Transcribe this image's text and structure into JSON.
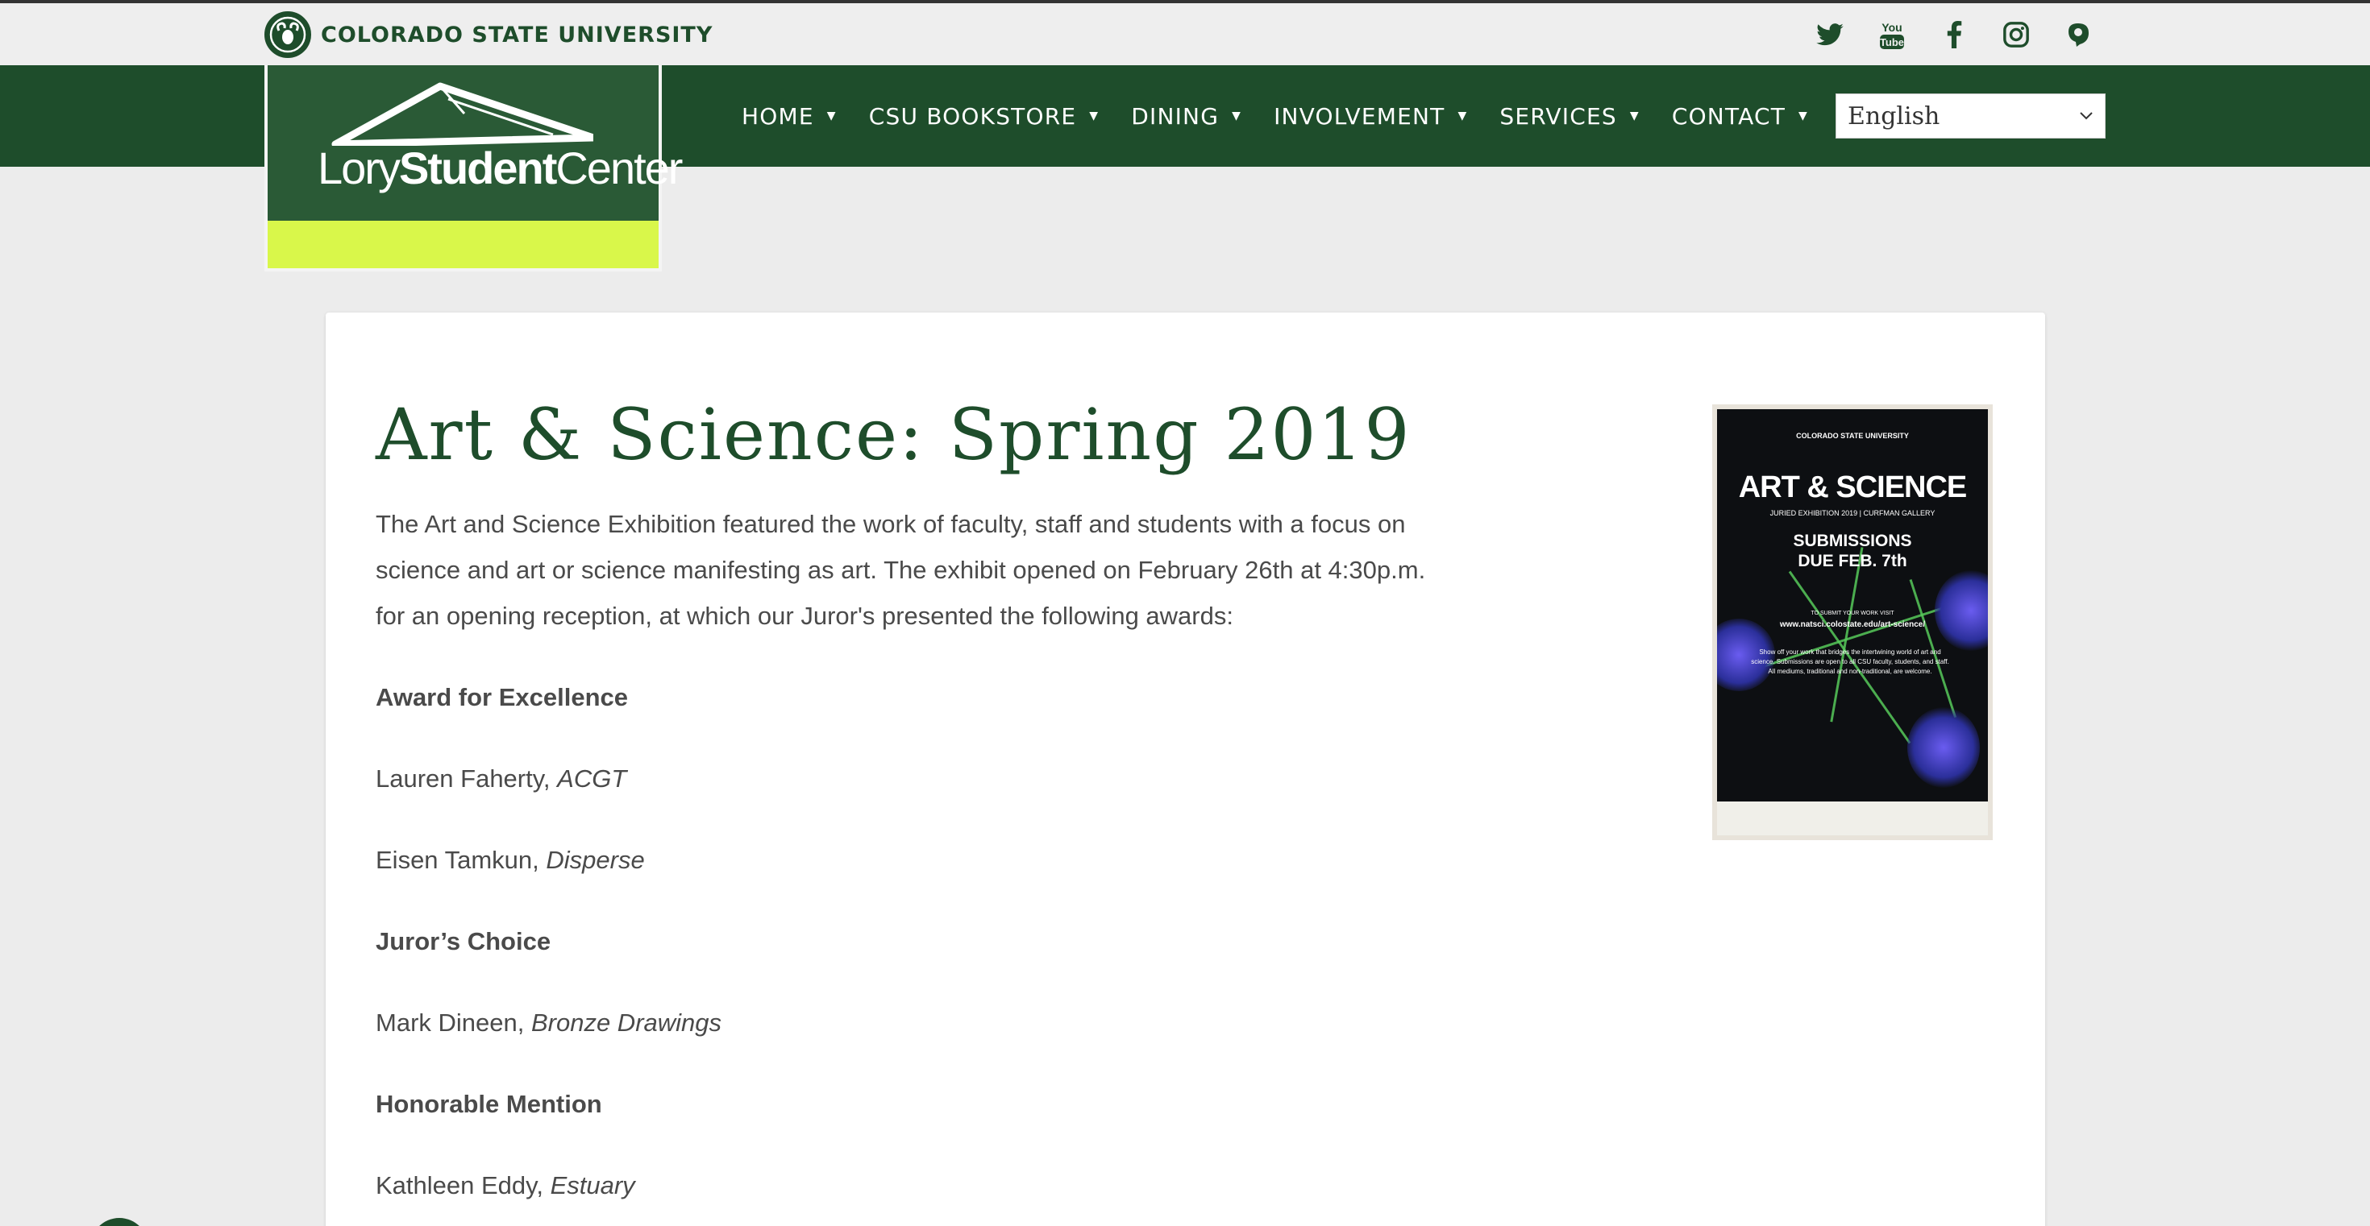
{
  "header": {
    "university_name": "COLORADO STATE UNIVERSITY",
    "social_icons": [
      "twitter-icon",
      "youtube-icon",
      "facebook-icon",
      "instagram-icon",
      "ram-icon"
    ],
    "youtube_label": "You Tube"
  },
  "logo": {
    "text_light_1": "Lory",
    "text_bold": "Student",
    "text_light_2": "Center"
  },
  "nav": {
    "items": [
      {
        "label": "HOME"
      },
      {
        "label": "CSU BOOKSTORE"
      },
      {
        "label": "DINING"
      },
      {
        "label": "INVOLVEMENT"
      },
      {
        "label": "SERVICES"
      },
      {
        "label": "CONTACT"
      }
    ],
    "language": "English"
  },
  "article": {
    "title": "Art & Science: Spring 2019",
    "intro": "The Art and Science Exhibition featured the work of faculty, staff and students with a focus on science and art or science manifesting as art. The exhibit opened on February 26th at 4:30p.m. for an opening reception, at which our Juror's presented the following awards:",
    "awards": [
      {
        "category": "Award for Excellence",
        "winners": [
          {
            "name": "Lauren Faherty, ",
            "work": "ACGT"
          },
          {
            "name": "Eisen Tamkun, ",
            "work": "Disperse"
          }
        ]
      },
      {
        "category": "Juror’s Choice",
        "winners": [
          {
            "name": "Mark Dineen, ",
            "work": "Bronze Drawings"
          }
        ]
      },
      {
        "category": "Honorable Mention",
        "winners": [
          {
            "name": "Kathleen Eddy, ",
            "work": "Estuary"
          }
        ]
      }
    ]
  },
  "poster": {
    "org": "COLORADO STATE UNIVERSITY",
    "title": "ART & SCIENCE",
    "subtitle": "JURIED EXHIBITION 2019 | CURFMAN GALLERY",
    "deadline_1": "SUBMISSIONS",
    "deadline_2": "DUE FEB. 7th",
    "visit_label": "TO SUBMIT YOUR WORK VISIT",
    "url": "www.natsci.colostate.edu/art-science/",
    "body": "Show off your work that bridges the intertwining world of art and science. Submissions are open to all CSU faculty, students, and staff. All mediums, traditional and non-traditional, are welcome."
  },
  "colors": {
    "csu_green": "#1e4d2b",
    "lime": "#d9f74a",
    "background": "#ececec"
  }
}
